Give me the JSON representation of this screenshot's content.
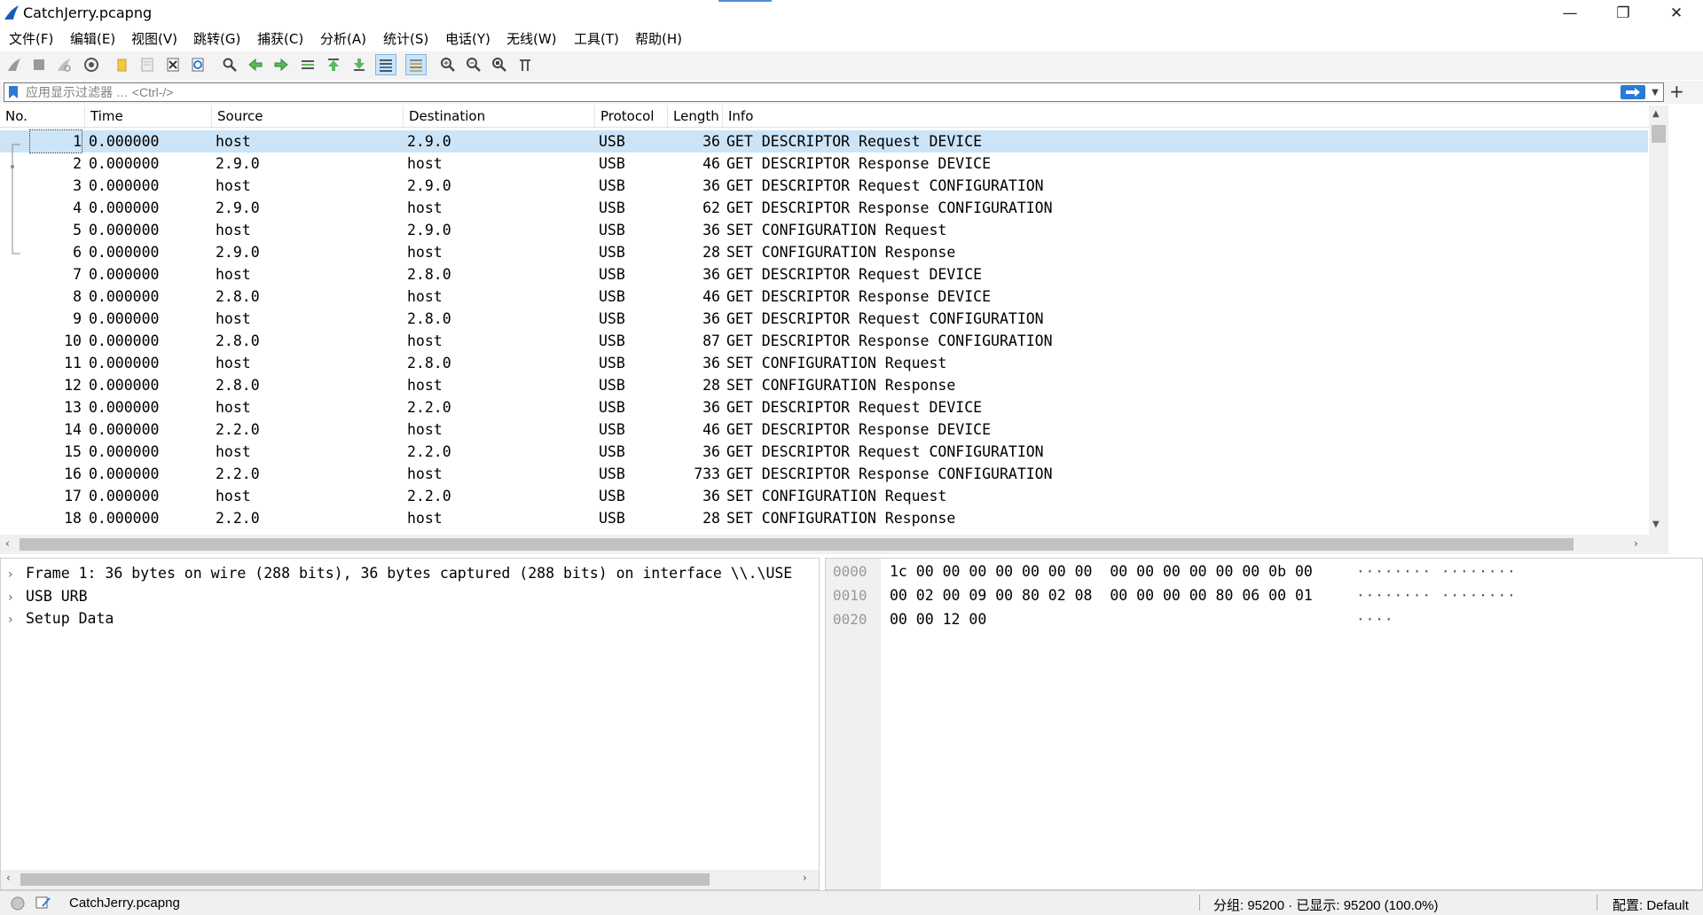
{
  "window": {
    "title": "CatchJerry.pcapng",
    "controls": [
      "—",
      "❐",
      "✕"
    ]
  },
  "menu": [
    "文件(F)",
    "编辑(E)",
    "视图(V)",
    "跳转(G)",
    "捕获(C)",
    "分析(A)",
    "统计(S)",
    "电话(Y)",
    "无线(W)",
    "工具(T)",
    "帮助(H)"
  ],
  "filter": {
    "placeholder": "应用显示过滤器 … <Ctrl-/>",
    "value": ""
  },
  "packet_list": {
    "columns": [
      "No.",
      "Time",
      "Source",
      "Destination",
      "Protocol",
      "Length",
      "Info"
    ],
    "rows": [
      {
        "no": "1",
        "time": "0.000000",
        "src": "host",
        "dst": "2.9.0",
        "proto": "USB",
        "len": "36",
        "info": "GET DESCRIPTOR Request DEVICE"
      },
      {
        "no": "2",
        "time": "0.000000",
        "src": "2.9.0",
        "dst": "host",
        "proto": "USB",
        "len": "46",
        "info": "GET DESCRIPTOR Response DEVICE"
      },
      {
        "no": "3",
        "time": "0.000000",
        "src": "host",
        "dst": "2.9.0",
        "proto": "USB",
        "len": "36",
        "info": "GET DESCRIPTOR Request CONFIGURATION"
      },
      {
        "no": "4",
        "time": "0.000000",
        "src": "2.9.0",
        "dst": "host",
        "proto": "USB",
        "len": "62",
        "info": "GET DESCRIPTOR Response CONFIGURATION"
      },
      {
        "no": "5",
        "time": "0.000000",
        "src": "host",
        "dst": "2.9.0",
        "proto": "USB",
        "len": "36",
        "info": "SET CONFIGURATION Request"
      },
      {
        "no": "6",
        "time": "0.000000",
        "src": "2.9.0",
        "dst": "host",
        "proto": "USB",
        "len": "28",
        "info": "SET CONFIGURATION Response"
      },
      {
        "no": "7",
        "time": "0.000000",
        "src": "host",
        "dst": "2.8.0",
        "proto": "USB",
        "len": "36",
        "info": "GET DESCRIPTOR Request DEVICE"
      },
      {
        "no": "8",
        "time": "0.000000",
        "src": "2.8.0",
        "dst": "host",
        "proto": "USB",
        "len": "46",
        "info": "GET DESCRIPTOR Response DEVICE"
      },
      {
        "no": "9",
        "time": "0.000000",
        "src": "host",
        "dst": "2.8.0",
        "proto": "USB",
        "len": "36",
        "info": "GET DESCRIPTOR Request CONFIGURATION"
      },
      {
        "no": "10",
        "time": "0.000000",
        "src": "2.8.0",
        "dst": "host",
        "proto": "USB",
        "len": "87",
        "info": "GET DESCRIPTOR Response CONFIGURATION"
      },
      {
        "no": "11",
        "time": "0.000000",
        "src": "host",
        "dst": "2.8.0",
        "proto": "USB",
        "len": "36",
        "info": "SET CONFIGURATION Request"
      },
      {
        "no": "12",
        "time": "0.000000",
        "src": "2.8.0",
        "dst": "host",
        "proto": "USB",
        "len": "28",
        "info": "SET CONFIGURATION Response"
      },
      {
        "no": "13",
        "time": "0.000000",
        "src": "host",
        "dst": "2.2.0",
        "proto": "USB",
        "len": "36",
        "info": "GET DESCRIPTOR Request DEVICE"
      },
      {
        "no": "14",
        "time": "0.000000",
        "src": "2.2.0",
        "dst": "host",
        "proto": "USB",
        "len": "46",
        "info": "GET DESCRIPTOR Response DEVICE"
      },
      {
        "no": "15",
        "time": "0.000000",
        "src": "host",
        "dst": "2.2.0",
        "proto": "USB",
        "len": "36",
        "info": "GET DESCRIPTOR Request CONFIGURATION"
      },
      {
        "no": "16",
        "time": "0.000000",
        "src": "2.2.0",
        "dst": "host",
        "proto": "USB",
        "len": "733",
        "info": "GET DESCRIPTOR Response CONFIGURATION"
      },
      {
        "no": "17",
        "time": "0.000000",
        "src": "host",
        "dst": "2.2.0",
        "proto": "USB",
        "len": "36",
        "info": "SET CONFIGURATION Request"
      },
      {
        "no": "18",
        "time": "0.000000",
        "src": "2.2.0",
        "dst": "host",
        "proto": "USB",
        "len": "28",
        "info": "SET CONFIGURATION Response"
      }
    ],
    "selected_row": 0
  },
  "details": [
    "Frame 1: 36 bytes on wire (288 bits), 36 bytes captured (288 bits) on interface \\\\.\\USE",
    "USB URB",
    "Setup Data"
  ],
  "bytes": [
    {
      "offset": "0000",
      "hex": "1c 00 00 00 00 00 00 00  00 00 00 00 00 00 0b 00",
      "ascii": "········ ········"
    },
    {
      "offset": "0010",
      "hex": "00 02 00 09 00 80 02 08  00 00 00 00 80 06 00 01",
      "ascii": "········ ········"
    },
    {
      "offset": "0020",
      "hex": "00 00 12 00",
      "ascii": "····"
    }
  ],
  "statusbar": {
    "file": "CatchJerry.pcapng",
    "counts": "分组: 95200 · 已显示: 95200 (100.0%)",
    "profile": "配置: Default"
  },
  "colors": {
    "selected_row": "#cce4f7",
    "filter_apply": "#2a7bd5",
    "toolbar_bg": "#f3f3f3"
  },
  "toolbar_icons": [
    "start-capture-icon",
    "stop-capture-icon",
    "restart-capture-icon",
    "capture-options-icon",
    "open-file-icon",
    "save-file-icon",
    "close-file-icon",
    "reload-file-icon",
    "find-packet-icon",
    "go-back-icon",
    "go-forward-icon",
    "go-to-packet-icon",
    "go-first-icon",
    "go-last-icon",
    "auto-scroll-icon",
    "colorize-icon",
    "zoom-in-icon",
    "zoom-out-icon",
    "normal-size-icon",
    "resize-columns-icon"
  ]
}
